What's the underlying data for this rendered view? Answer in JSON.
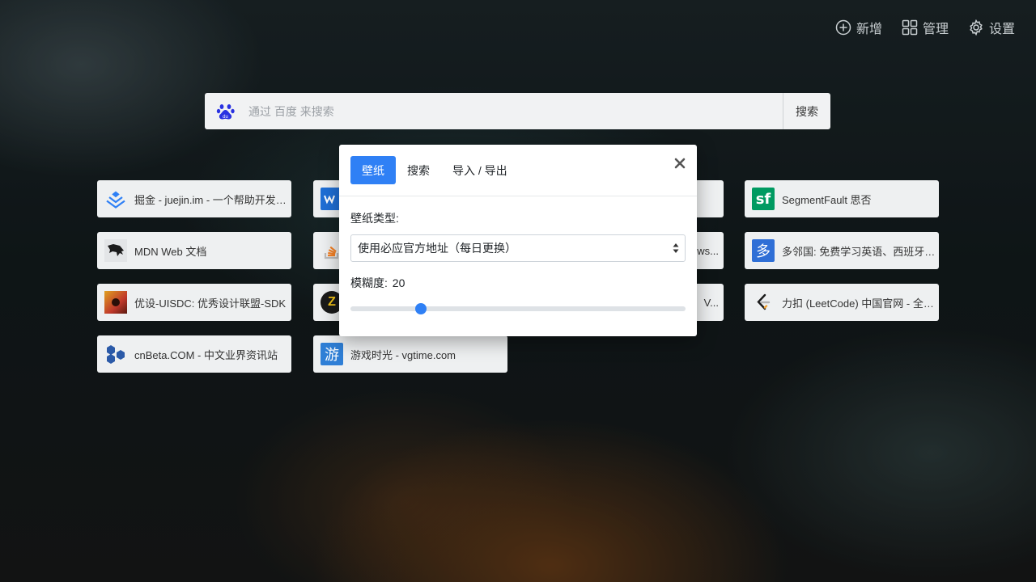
{
  "toolbar": {
    "add_label": "新增",
    "manage_label": "管理",
    "settings_label": "设置"
  },
  "search": {
    "placeholder": "通过 百度 来搜索",
    "button_label": "搜索",
    "engine_icon": "baidu-paw-icon"
  },
  "bookmarks": [
    {
      "label": "掘金 - juejin.im - 一个帮助开发者成长的社区",
      "icon": "juejin-icon",
      "icon_text": "",
      "color": "#2f80f5"
    },
    {
      "label": "",
      "icon": "partial-icon",
      "icon_text": "",
      "color": "#1f6fd6"
    },
    {
      "label": "",
      "icon": "hidden-icon",
      "icon_text": "",
      "color": "#888888"
    },
    {
      "label": "SegmentFault 思否",
      "icon": "segmentfault-icon",
      "icon_text": "sf",
      "color": "#009a61"
    },
    {
      "label": "MDN Web 文档",
      "icon": "mdn-dinosaur-icon",
      "icon_text": "",
      "color": "#1b1b1b"
    },
    {
      "label": "",
      "icon": "stackoverflow-icon",
      "icon_text": "",
      "color": "#f48024"
    },
    {
      "label": "ws...",
      "icon": "hidden-icon",
      "icon_text": "",
      "color": "#888888"
    },
    {
      "label": "多邻国: 免费学习英语、西班牙语、法语",
      "icon": "duolingo-icon",
      "icon_text": "多",
      "color": "#2f6fd6"
    },
    {
      "label": "优设-UISDC: 优秀设计联盟-SDK",
      "icon": "uisdc-icon",
      "icon_text": "",
      "color": "#c0392b"
    },
    {
      "label": "",
      "icon": "zhihu-z-icon",
      "icon_text": "Z",
      "color": "#1a1a1a"
    },
    {
      "label": "V...",
      "icon": "hidden-icon",
      "icon_text": "",
      "color": "#888888"
    },
    {
      "label": "力扣 (LeetCode) 中国官网 - 全球极客挚爱的技术成长平台",
      "icon": "leetcode-icon",
      "icon_text": "",
      "color": "#f0a030"
    },
    {
      "label": "cnBeta.COM - 中文业界资讯站",
      "icon": "cnbeta-hexagon-icon",
      "icon_text": "",
      "color": "#2b5aa8"
    },
    {
      "label": "游戏时光 - vgtime.com",
      "icon": "vgtime-icon",
      "icon_text": "游",
      "color": "#2f7fd6"
    }
  ],
  "modal": {
    "tabs": [
      {
        "label": "壁纸",
        "active": true
      },
      {
        "label": "搜索",
        "active": false
      },
      {
        "label": "导入 / 导出",
        "active": false
      }
    ],
    "wallpaper_type_label": "壁纸类型:",
    "wallpaper_type_value": "使用必应官方地址（每日更换）",
    "blur_label": "模糊度:",
    "blur_value": "20",
    "blur_fraction": 0.2
  },
  "colors": {
    "accent": "#2f80f5",
    "tile_bg": "#eef0f1",
    "toolbar_text": "#c9cfd2"
  }
}
